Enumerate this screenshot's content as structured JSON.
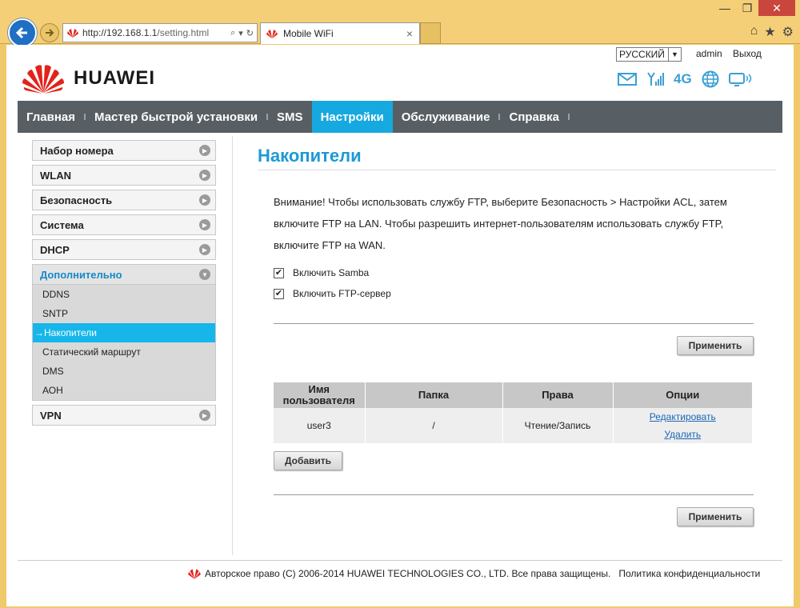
{
  "browser": {
    "url_host": "http://192.168.1.1",
    "url_path": "/setting.html",
    "tab_title": "Mobile WiFi",
    "tab_close": "×",
    "address_tools": [
      "⌕",
      "▾",
      "↻"
    ],
    "window_buttons": [
      "—",
      "❐",
      "✕"
    ],
    "right_icons": [
      "⌂",
      "★",
      "⚙"
    ]
  },
  "header": {
    "language": "РУССКИЙ",
    "user": "admin",
    "logout": "Выход",
    "brand": "HUAWEI",
    "network": "4G"
  },
  "nav": {
    "items": [
      {
        "label": "Главная"
      },
      {
        "label": "Мастер быстрой установки"
      },
      {
        "label": "SMS"
      },
      {
        "label": "Настройки"
      },
      {
        "label": "Обслуживание"
      },
      {
        "label": "Справка"
      }
    ]
  },
  "sidebar": {
    "items": [
      {
        "label": "Набор номера"
      },
      {
        "label": "WLAN"
      },
      {
        "label": "Безопасность"
      },
      {
        "label": "Система"
      },
      {
        "label": "DHCP"
      },
      {
        "label": "Дополнительно"
      },
      {
        "label": "VPN"
      }
    ],
    "subitems": [
      {
        "label": "DDNS"
      },
      {
        "label": "SNTP"
      },
      {
        "label": "→Накопители"
      },
      {
        "label": "Статический маршрут"
      },
      {
        "label": "DMS"
      },
      {
        "label": "АОН"
      }
    ]
  },
  "content": {
    "title": "Накопители",
    "notice": "Внимание! Чтобы использовать службу FTP, выберите Безопасность > Настройки ACL, затем включите FTP на LAN. Чтобы разрешить интернет-пользователям использовать службу FTP, включите FTP на WAN.",
    "samba_label": "Включить Samba",
    "ftp_label": "Включить FTP-сервер",
    "check_mark": "✔",
    "apply_label": "Применить",
    "add_label": "Добавить",
    "table": {
      "headers": [
        "Имя пользователя",
        "Папка",
        "Права",
        "Опции"
      ],
      "rows": [
        {
          "user": "user3",
          "folder": "/",
          "rights": "Чтение/Запись",
          "edit": "Редактировать",
          "delete": "Удалить"
        }
      ]
    }
  },
  "footer": {
    "copyright": "Авторское право (C) 2006-2014 HUAWEI TECHNOLOGIES CO., LTD. Все права защищены.",
    "privacy": "Политика конфиденциальности"
  },
  "colors": {
    "accent": "#16a9df",
    "nav_bg": "#585f64",
    "title": "#1c9ad6",
    "link": "#1a66b5",
    "brand_red": "#e2231a"
  }
}
